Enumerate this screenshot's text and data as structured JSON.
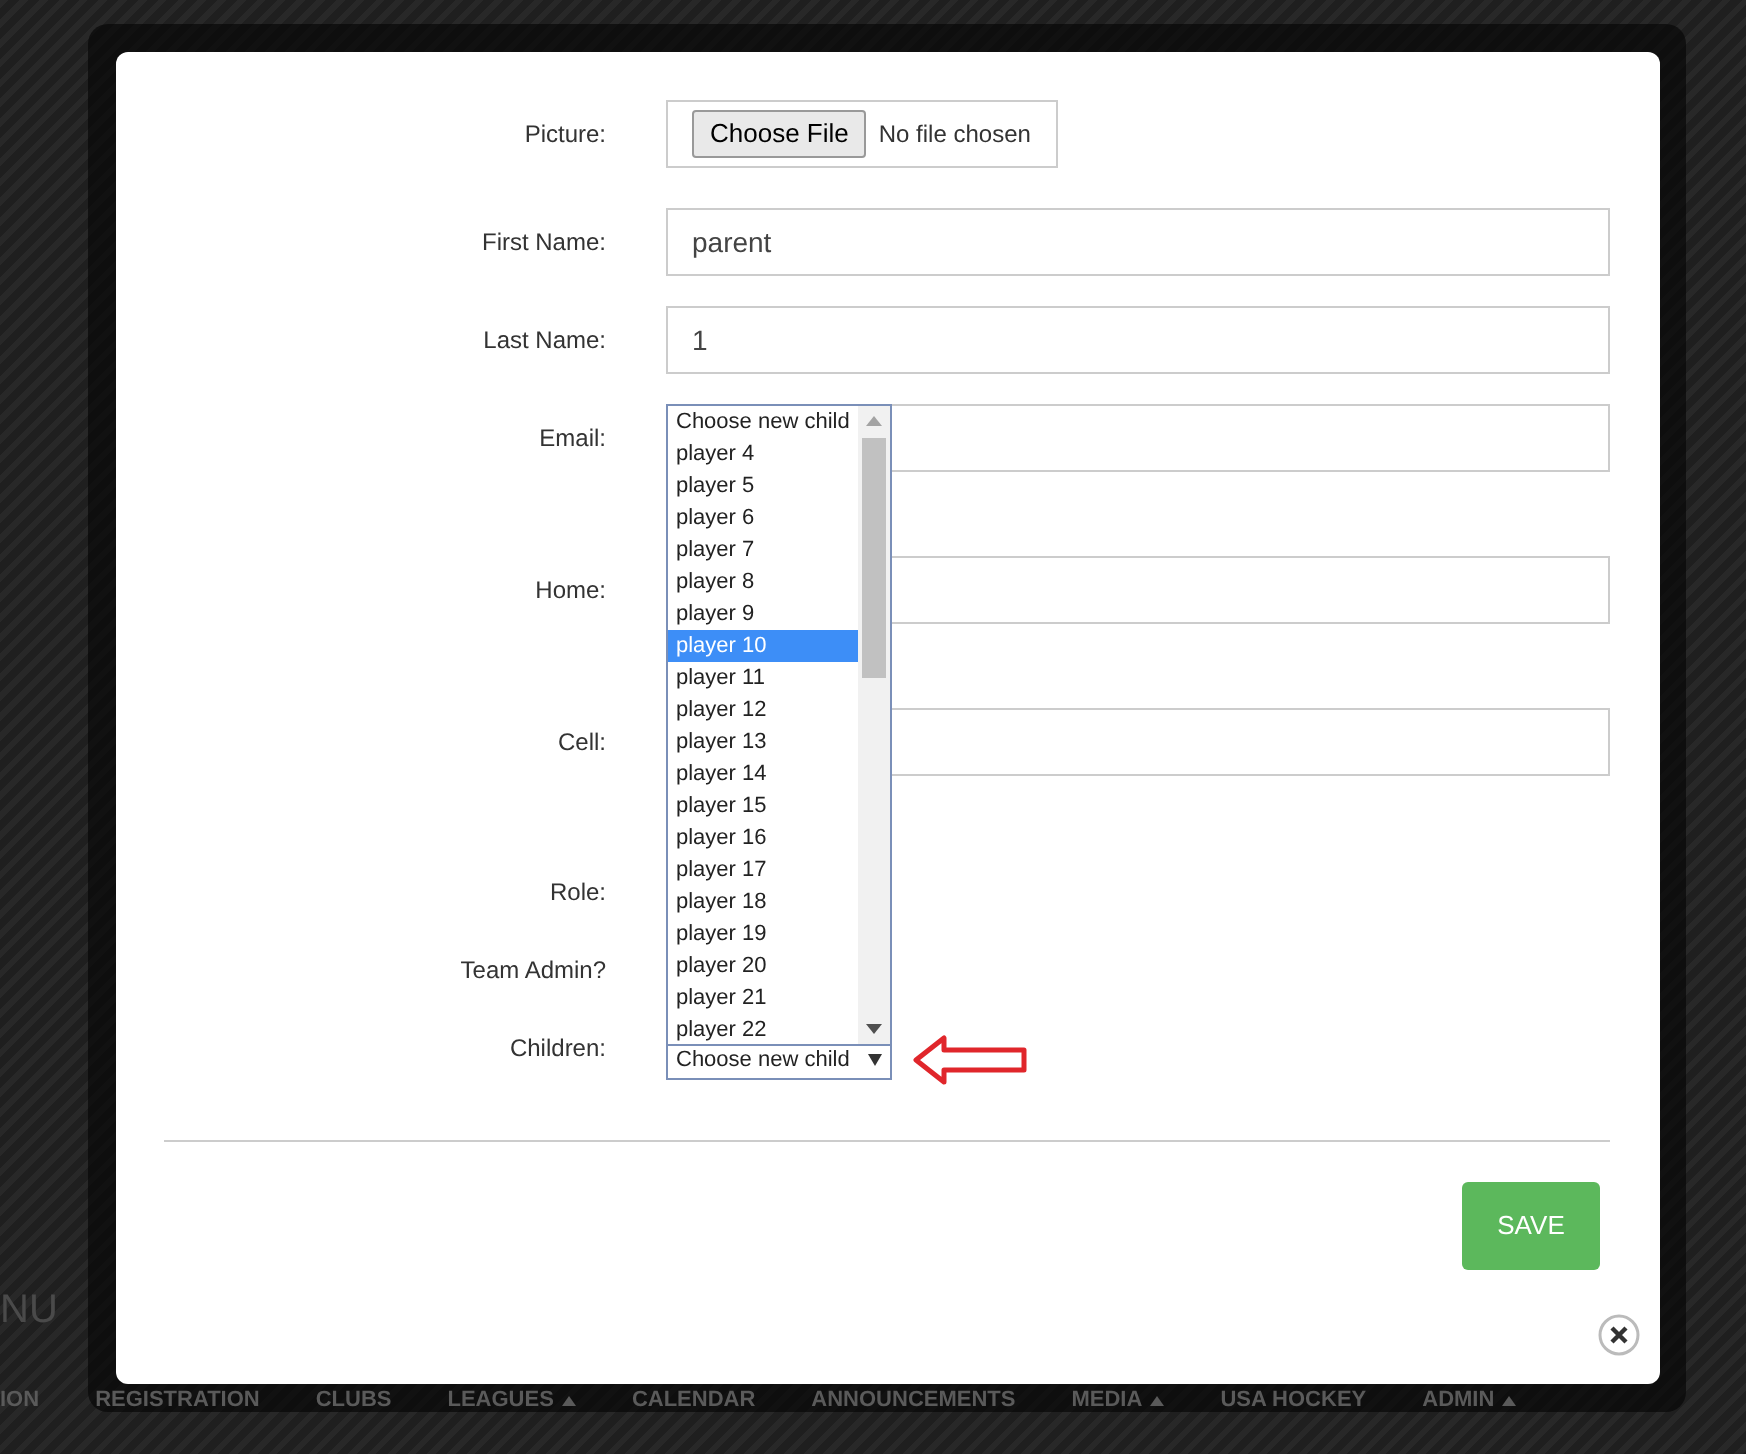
{
  "background": {
    "menu_label": "NU",
    "nav_items": [
      {
        "label": "ION",
        "caret": false
      },
      {
        "label": "REGISTRATION",
        "caret": false
      },
      {
        "label": "CLUBS",
        "caret": false
      },
      {
        "label": "LEAGUES",
        "caret": true
      },
      {
        "label": "CALENDAR",
        "caret": false
      },
      {
        "label": "ANNOUNCEMENTS",
        "caret": false
      },
      {
        "label": "MEDIA",
        "caret": true
      },
      {
        "label": "USA HOCKEY",
        "caret": false
      },
      {
        "label": "ADMIN",
        "caret": true
      }
    ]
  },
  "form": {
    "fields": [
      {
        "kind": "file",
        "label": "Picture:",
        "button": "Choose File",
        "status": "No file chosen"
      },
      {
        "kind": "text",
        "label": "First Name:",
        "value": "parent"
      },
      {
        "kind": "text",
        "label": "Last Name:",
        "value": "1"
      },
      {
        "kind": "text",
        "label": "Email:"
      },
      {
        "kind": "text",
        "label": "Home:"
      },
      {
        "kind": "text",
        "label": "Cell:"
      },
      {
        "kind": "blank",
        "label": "Role:"
      },
      {
        "kind": "blank",
        "label": "Team Admin?"
      },
      {
        "kind": "select",
        "label": "Children:",
        "value": "Choose new child"
      }
    ]
  },
  "dropdown": {
    "options": [
      {
        "label": "Choose new child",
        "selected": false
      },
      {
        "label": "player 4",
        "selected": false
      },
      {
        "label": "player 5",
        "selected": false
      },
      {
        "label": "player 6",
        "selected": false
      },
      {
        "label": "player 7",
        "selected": false
      },
      {
        "label": "player 8",
        "selected": false
      },
      {
        "label": "player 9",
        "selected": false
      },
      {
        "label": "player 10",
        "selected": true
      },
      {
        "label": "player 11",
        "selected": false
      },
      {
        "label": "player 12",
        "selected": false
      },
      {
        "label": "player 13",
        "selected": false
      },
      {
        "label": "player 14",
        "selected": false
      },
      {
        "label": "player 15",
        "selected": false
      },
      {
        "label": "player 16",
        "selected": false
      },
      {
        "label": "player 17",
        "selected": false
      },
      {
        "label": "player 18",
        "selected": false
      },
      {
        "label": "player 19",
        "selected": false
      },
      {
        "label": "player 20",
        "selected": false
      },
      {
        "label": "player 21",
        "selected": false
      },
      {
        "label": "player 22",
        "selected": false
      }
    ]
  },
  "save_button": "SAVE"
}
